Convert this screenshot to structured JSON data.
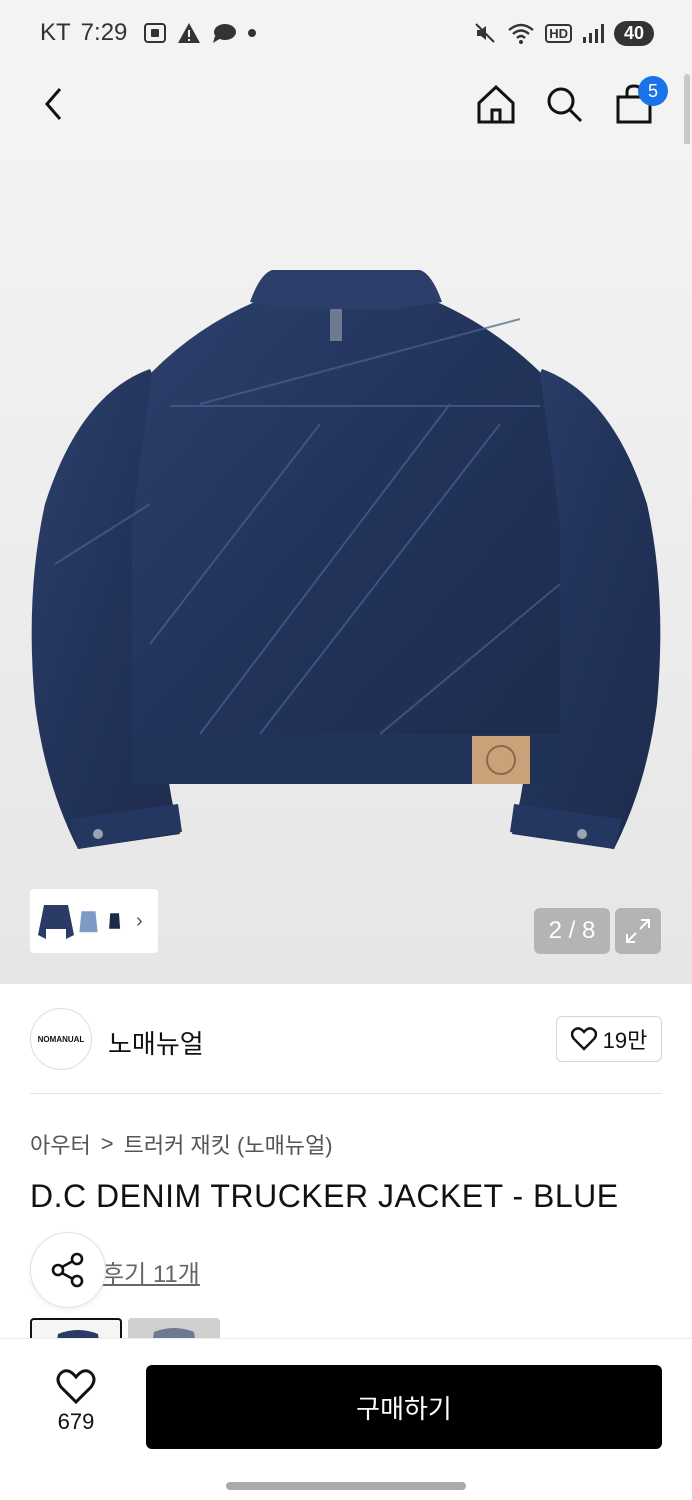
{
  "status_bar": {
    "carrier": "KT",
    "time": "7:29",
    "battery": "40",
    "network_badge": "HD"
  },
  "header": {
    "cart_count": "5"
  },
  "gallery": {
    "page_indicator": "2 / 8"
  },
  "brand": {
    "logo_text": "NOMANUAL",
    "name": "노매뉴얼",
    "like_count": "19만"
  },
  "breadcrumb": {
    "category": "아우터",
    "separator": ">",
    "subcategory": "트러커 재킷 (노매뉴얼)"
  },
  "product": {
    "title": "D.C DENIM TRUCKER JACKET - BLUE",
    "review_link": "후기 11개"
  },
  "bottom_bar": {
    "like_count": "679",
    "buy_label": "구매하기"
  },
  "colors": {
    "accent_badge": "#1a73e8",
    "denim": "#2a3c66",
    "buy_button": "#000000"
  }
}
